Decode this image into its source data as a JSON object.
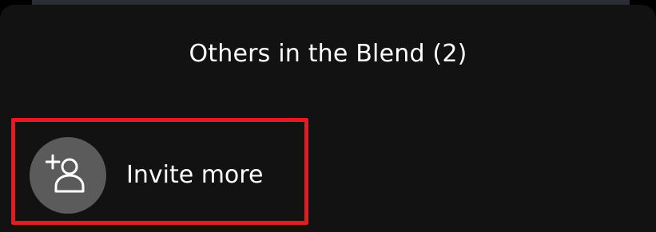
{
  "sheet": {
    "title": "Others in the Blend (2)"
  },
  "invite": {
    "label": "Invite more",
    "icon": "add-person-icon"
  },
  "colors": {
    "sheet_background": "#121212",
    "highlight_border": "#e31b23",
    "avatar_background": "#5b5b5b",
    "text": "#ffffff"
  }
}
